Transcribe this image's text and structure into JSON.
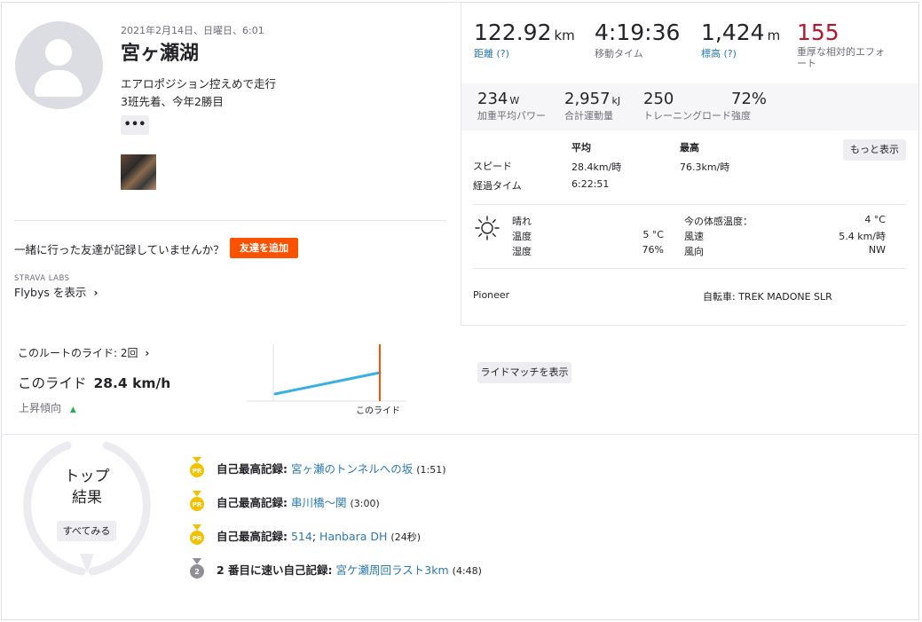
{
  "activity": {
    "date": "2021年2月14日、日曜日、6:01",
    "title": "宮ヶ瀬湖",
    "description_line1": "エアロポジション控えめで走行",
    "description_line2": "3班先着、今年2勝目",
    "more_button": "•••"
  },
  "friends": {
    "prompt": "一緒に行った友達が記録していませんか？",
    "add_button": "友達を追加",
    "labs_label": "STRAVA LABS",
    "flybys_link": "Flybys を表示"
  },
  "stats_primary": [
    {
      "value": "122.92",
      "unit": "km",
      "label": "距離",
      "help": "(?)"
    },
    {
      "value": "4:19:36",
      "unit": "",
      "label": "移動タイム",
      "help": ""
    },
    {
      "value": "1,424",
      "unit": "m",
      "label": "標高",
      "help": "(?)"
    },
    {
      "value": "155",
      "unit": "",
      "label_line1": "重厚な相対的エフォ",
      "label_line2": "ート"
    }
  ],
  "stats_secondary": [
    {
      "value": "234",
      "unit": "W",
      "label": "加重平均パワー"
    },
    {
      "value": "2,957",
      "unit": "kJ",
      "label": "合計運動量"
    },
    {
      "value": "250",
      "unit": "",
      "label": "トレーニングロード"
    },
    {
      "value": "72%",
      "unit": "",
      "label": "強度"
    }
  ],
  "speed_table": {
    "col_avg": "平均",
    "col_max": "最高",
    "more_button": "もっと表示",
    "speed_label": "スピード",
    "speed_avg": "28.4km/時",
    "speed_max": "76.3km/時",
    "elapsed_label": "経過タイム",
    "elapsed_avg": "6:22:51"
  },
  "weather": {
    "condition": "晴れ",
    "temp_label": "温度",
    "temp_value": "5 °C",
    "humidity_label": "湿度",
    "humidity_value": "76%",
    "feels_label": "今の体感温度：",
    "feels_value": "4 °C",
    "wind_speed_label": "風速",
    "wind_speed_value": "5.4 km/時",
    "wind_dir_label": "風向",
    "wind_dir_value": "NW"
  },
  "devices": {
    "device": "Pioneer",
    "bike": "自転車: TREK MADONE SLR"
  },
  "route": {
    "rides_label": "このルートのライド: 2回",
    "this_ride_prefix": "このライド",
    "this_ride_speed": "28.4 km/h",
    "trend_label": "上昇傾向",
    "chart_marker_label": "このライド",
    "match_button": "ライドマッチを表示"
  },
  "chart_data": {
    "type": "line",
    "series": [
      {
        "values": [
          1,
          2
        ]
      }
    ],
    "marker": "このライド"
  },
  "top_results": {
    "title_line1": "トップ",
    "title_line2": "結果",
    "see_all_button": "すべてみる",
    "items": [
      {
        "badge": "PR",
        "kind": "自己最高記録:",
        "segment": "宮ヶ瀬のトンネルへの坂",
        "time": "(1:51)"
      },
      {
        "badge": "PR",
        "kind": "自己最高記録:",
        "segment": "串川橋～関",
        "time": "(3:00)"
      },
      {
        "badge": "PR",
        "kind": "自己最高記録:",
        "segment_a": "514",
        "sep": ";",
        "segment_b": "Hanbara DH",
        "time": "(24秒)"
      },
      {
        "badge": "2",
        "kind": "2 番目に速い自己記録:",
        "segment": "宮ケ瀬周回ラスト3km",
        "time": "(4:48)"
      }
    ]
  },
  "colors": {
    "brand": "#fc5200",
    "link": "#2a7ab0",
    "effort_red": "#b4182e",
    "medal_gold": "#f2c200",
    "medal_silver": "#8f8f96",
    "chart_line": "#3ab0e2",
    "chart_marker": "#fc5200",
    "trend_up": "#27ae60"
  }
}
